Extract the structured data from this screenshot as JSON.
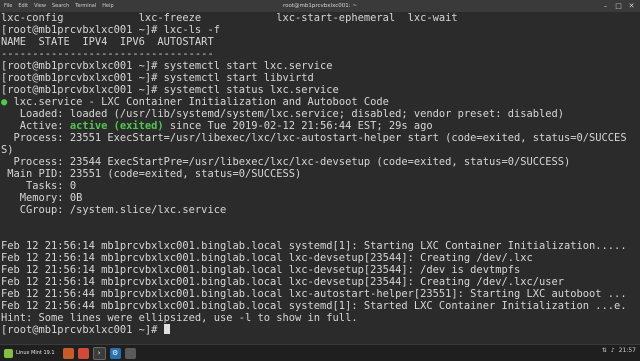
{
  "window": {
    "title": "root@mb1prcvbxlxc001: ~",
    "menus": [
      "File",
      "Edit",
      "View",
      "Search",
      "Terminal",
      "Help"
    ],
    "controls": {
      "minimize": "–",
      "maximize": "□",
      "close": "✕"
    }
  },
  "terminal": {
    "lines": [
      "lxc-config            lxc-freeze            lxc-start-ephemeral  lxc-wait",
      "[root@mb1prcvbxlxc001 ~]# lxc-ls -f",
      "NAME  STATE  IPV4  IPV6  AUTOSTART",
      "----------------------------------",
      "[root@mb1prcvbxlxc001 ~]# systemctl start lxc.service",
      "[root@mb1prcvbxlxc001 ~]# systemctl start libvirtd",
      "[root@mb1prcvbxlxc001 ~]# systemctl status lxc.service",
      "● lxc.service - LXC Container Initialization and Autoboot Code",
      "   Loaded: loaded (/usr/lib/systemd/system/lxc.service; disabled; vendor preset: disabled)",
      "   Active: ",
      "  Process: 23551 ExecStart=/usr/libexec/lxc/lxc-autostart-helper start (code=exited, status=0/SUCCES",
      "S)",
      "  Process: 23544 ExecStartPre=/usr/libexec/lxc/lxc-devsetup (code=exited, status=0/SUCCESS)",
      " Main PID: 23551 (code=exited, status=0/SUCCESS)",
      "    Tasks: 0",
      "   Memory: 0B",
      "   CGroup: /system.slice/lxc.service",
      "",
      "Feb 12 21:56:14 mb1prcvbxlxc001.binglab.local systemd[1]: Starting LXC Container Initialization.....",
      "Feb 12 21:56:14 mb1prcvbxlxc001.binglab.local lxc-devsetup[23544]: Creating /dev/.lxc",
      "Feb 12 21:56:14 mb1prcvbxlxc001.binglab.local lxc-devsetup[23544]: /dev is devtmpfs",
      "Feb 12 21:56:14 mb1prcvbxlxc001.binglab.local lxc-devsetup[23544]: Creating /dev/.lxc/user",
      "Feb 12 21:56:44 mb1prcvbxlxc001.binglab.local lxc-autostart-helper[23551]: Starting LXC autoboot ...",
      "Feb 12 21:56:44 mb1prcvbxlxc001.binglab.local systemd[1]: Started LXC Container Initialization ...e.",
      "Hint: Some lines were ellipsized, use -l to show in full.",
      "[root@mb1prcvbxlxc001 ~]# "
    ],
    "active_status": "active (exited)",
    "active_rest": " since Tue 2019-02-12 21:56:44 EST; 29s ago",
    "colors": {
      "background": "#2b2b2b",
      "text": "#d6d6d6",
      "active": "#4ec94e"
    }
  },
  "taskbar": {
    "menu_label": "Linux Mint 19.1",
    "launchers": [
      "files-icon",
      "firefox-icon",
      "terminal-icon",
      "settings-icon",
      "app-icon"
    ],
    "tray": [
      "network-icon",
      "volume-icon",
      "clock-icon"
    ],
    "clock": "21:57"
  }
}
